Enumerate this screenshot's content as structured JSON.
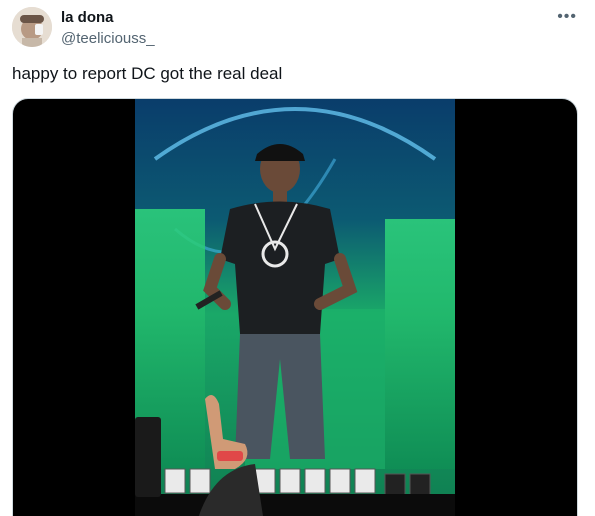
{
  "author": {
    "display_name": "la dona",
    "handle": "@teeliciouss_"
  },
  "more_label": "•••",
  "tweet_text": "happy to report DC got the real deal",
  "media": {
    "type": "video-still",
    "background": "#000000",
    "stage_color": "#1fc46e",
    "screen_color": "#0a3d6b"
  }
}
